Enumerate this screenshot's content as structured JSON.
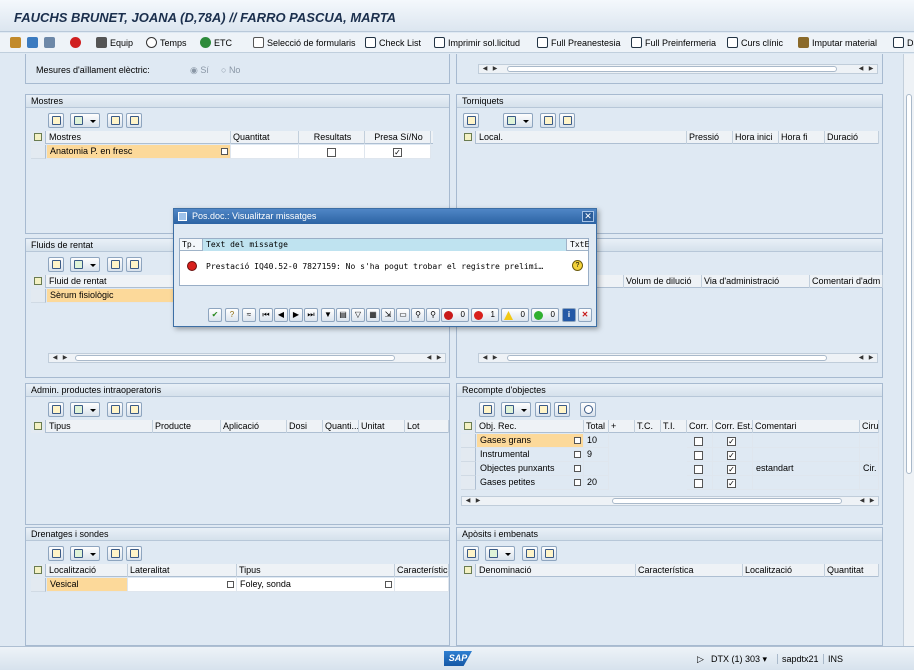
{
  "window": {
    "title": "FAUCHS BRUNET, JOANA (D,78A) // FARRO PASCUA, MARTA"
  },
  "toolbar": {
    "equip": "Equip",
    "temps": "Temps",
    "etc": "ETC",
    "seleccio": "Selecció de formularis",
    "checklist": "Check List",
    "imprimir": "Imprimir sol.licitud",
    "preanestesia": "Full Preanestesia",
    "preinfermeria": "Full Preinfermeria",
    "curs": "Curs clínic",
    "imputar": "Imputar material",
    "extra": "Da"
  },
  "top_section": {
    "partial_label": "Mesures d'aïllament elèctric:",
    "radio_yes": "Sí",
    "radio_no": "No"
  },
  "mostres": {
    "title": "Mostres",
    "headers": [
      "Mostres",
      "Quantitat",
      "Resultats",
      "Presa Sí/No"
    ],
    "row": {
      "name": "Anatomia P. en fresc",
      "quantitat": "",
      "resultats": false,
      "presa": true
    }
  },
  "torniquets": {
    "title": "Torniquets",
    "headers": [
      "Local.",
      "Pressió",
      "Hora inici",
      "Hora fi",
      "Duració"
    ]
  },
  "fluids": {
    "title": "Fluids de rentat",
    "headers": [
      "Fluid de rentat",
      "Volum de dilució",
      "Via d'administració",
      "Comentari d'adm"
    ],
    "row": {
      "name": "Sèrum fisiològic"
    }
  },
  "admin": {
    "title": "Admin. productes intraoperatoris",
    "headers": [
      "Tipus",
      "Producte",
      "Aplicació",
      "Dosi",
      "Quanti...",
      "Unitat",
      "Lot"
    ]
  },
  "recompte": {
    "title": "Recompte d'objectes",
    "headers": [
      "Obj. Rec.",
      "Total",
      "+",
      "T.C.",
      "T.I.",
      "Corr.",
      "Corr. Est.",
      "Comentari",
      "Ciru"
    ],
    "rows": [
      {
        "obj": "Gases grans",
        "total": "10",
        "corr": false,
        "corr_est": true,
        "comentari": "",
        "ciru": ""
      },
      {
        "obj": "Instrumental",
        "total": "9",
        "corr": false,
        "corr_est": true,
        "comentari": "",
        "ciru": ""
      },
      {
        "obj": "Objectes punxants",
        "total": "",
        "corr": false,
        "corr_est": true,
        "comentari": "estandart",
        "ciru": "Cir."
      },
      {
        "obj": "Gases petites",
        "total": "20",
        "corr": false,
        "corr_est": true,
        "comentari": "",
        "ciru": ""
      }
    ]
  },
  "drenatges": {
    "title": "Drenatges i sondes",
    "headers": [
      "Localització",
      "Lateralitat",
      "Tipus",
      "Característica"
    ],
    "row": {
      "loc": "Vesical",
      "lat": "",
      "tipus": "Foley, sonda",
      "car": ""
    }
  },
  "aposits": {
    "title": "Apòsits i embenats",
    "headers": [
      "Denominació",
      "Característica",
      "Localització",
      "Quantitat"
    ]
  },
  "dialog": {
    "title": "Pos.doc.: Visualitzar missatges",
    "col_tp": "Tp.",
    "col_text": "Text del missatge",
    "col_txte": "TxtE",
    "message": "Prestació IQ40.52-0 7827159: No s'ha pogut trobar el registre prelimi…",
    "count_stop": "0",
    "count_error": "1",
    "count_warning": "0",
    "count_success": "0"
  },
  "status": {
    "system": "DTX (1) 303",
    "server": "sapdtx21",
    "mode": "INS",
    "logo": "SAP"
  }
}
